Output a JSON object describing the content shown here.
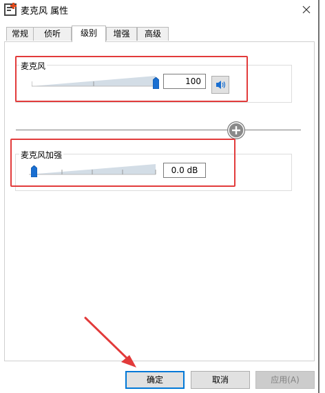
{
  "window": {
    "title": "麦克风 属性",
    "close_glyph": "✕",
    "icon": "microphone-app-icon"
  },
  "tabs": [
    {
      "label": "常规",
      "active": false
    },
    {
      "label": "侦听",
      "active": false
    },
    {
      "label": "级别",
      "active": true
    },
    {
      "label": "增强",
      "active": false
    },
    {
      "label": "高级",
      "active": false
    }
  ],
  "microphone": {
    "label": "麦克风",
    "level_value": "100",
    "level_fraction": 1.0,
    "mute_icon": "speaker-icon"
  },
  "boost": {
    "label": "麦克风加强",
    "value": "0.0 dB",
    "level_fraction": 0.0
  },
  "buttons": {
    "ok": "确定",
    "cancel": "取消",
    "apply": "应用(A)"
  },
  "colors": {
    "highlight": "#e23a3a",
    "accent": "#0078d7",
    "slider_thumb": "#1a6fd1"
  }
}
